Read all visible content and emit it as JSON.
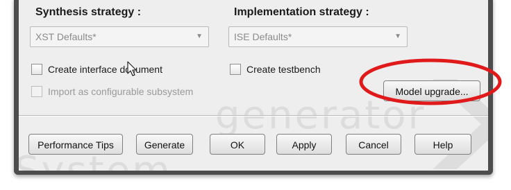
{
  "synthesis": {
    "label": "Synthesis strategy :",
    "value": "XST Defaults*"
  },
  "implementation": {
    "label": "Implementation strategy :",
    "value": "ISE Defaults*"
  },
  "options": {
    "create_interface_document": "Create interface document",
    "create_testbench": "Create testbench",
    "import_configurable_subsystem": "Import as configurable subsystem"
  },
  "model_upgrade_label": "Model upgrade...",
  "buttons": {
    "performance_tips": "Performance Tips",
    "generate": "Generate",
    "ok": "OK",
    "apply": "Apply",
    "cancel": "Cancel",
    "help": "Help"
  },
  "watermark": {
    "line1": "generator",
    "line2": "System"
  },
  "colors": {
    "highlight_ring": "#e01a1a",
    "dialog_background": "#eeeeee",
    "window_frame": "#4d4d4d"
  }
}
